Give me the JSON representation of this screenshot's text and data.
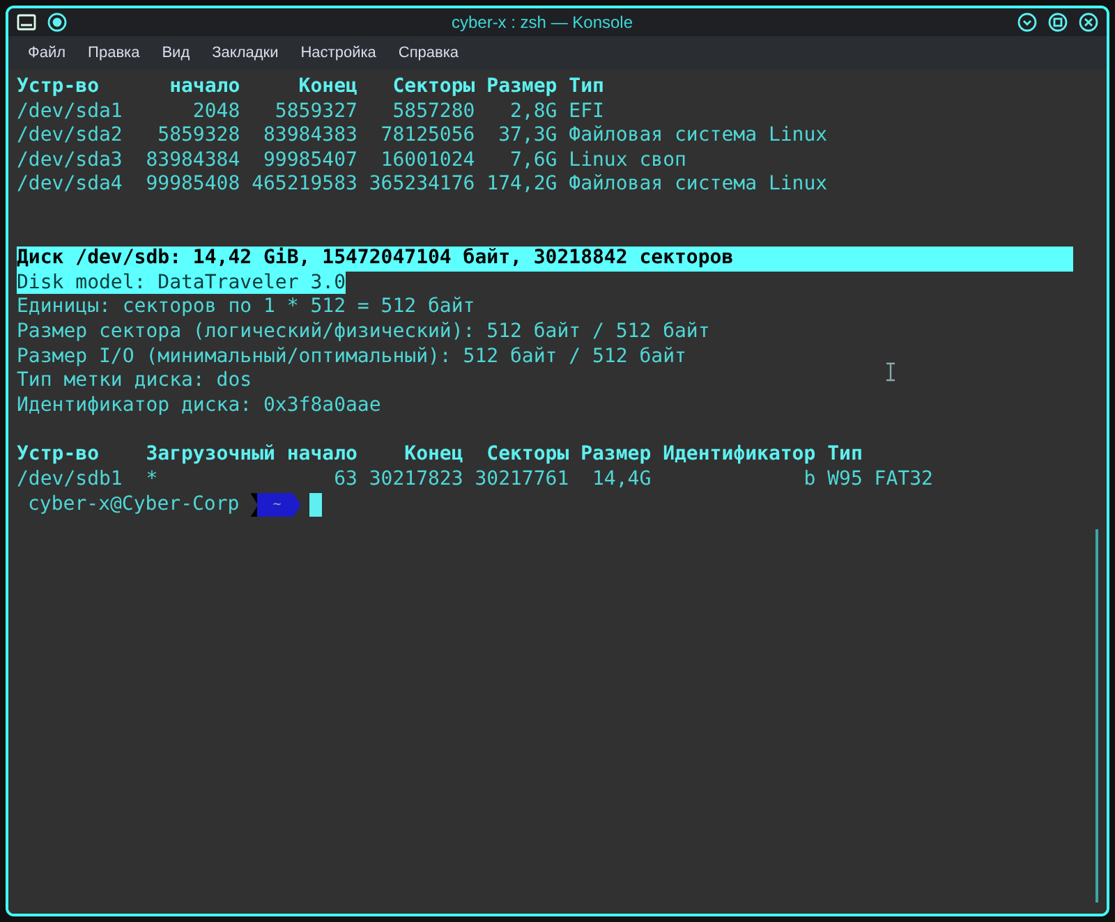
{
  "window": {
    "title": "cyber-x : zsh — Konsole"
  },
  "menu": [
    "Файл",
    "Правка",
    "Вид",
    "Закладки",
    "Настройка",
    "Справка"
  ],
  "terminal": {
    "lines": [
      {
        "kind": "header",
        "text": "Устр-во      начало     Конец   Секторы Размер Тип"
      },
      {
        "kind": "output",
        "text": "/dev/sda1      2048   5859327   5857280   2,8G EFI"
      },
      {
        "kind": "output",
        "text": "/dev/sda2   5859328  83984383  78125056  37,3G Файловая система Linux"
      },
      {
        "kind": "output",
        "text": "/dev/sda3  83984384  99985407  16001024   7,6G Linux своп"
      },
      {
        "kind": "output",
        "text": "/dev/sda4  99985408 465219583 365234176 174,2G Файловая система Linux"
      },
      {
        "kind": "blank"
      },
      {
        "kind": "blank"
      },
      {
        "kind": "selected_header",
        "text": "Диск /dev/sdb: 14,42 GiB, 15472047104 байт, 30218842 секторов"
      },
      {
        "kind": "selected",
        "text": "Disk model: DataTraveler 3.0"
      },
      {
        "kind": "output",
        "text": "Единицы: секторов по 1 * 512 = 512 байт"
      },
      {
        "kind": "output",
        "text": "Размер сектора (логический/физический): 512 байт / 512 байт"
      },
      {
        "kind": "output",
        "text": "Размер I/O (минимальный/оптимальный): 512 байт / 512 байт"
      },
      {
        "kind": "output",
        "text": "Тип метки диска: dos"
      },
      {
        "kind": "output",
        "text": "Идентификатор диска: 0x3f8a0aae"
      },
      {
        "kind": "blank"
      },
      {
        "kind": "header",
        "text": "Устр-во    Загрузочный начало    Конец  Секторы Размер Идентификатор Тип"
      },
      {
        "kind": "output",
        "text": "/dev/sdb1  *               63 30217823 30217761  14,4G             b W95 FAT32"
      }
    ],
    "prompt": {
      "user_host": "cyber-x@Cyber-Corp",
      "path": "~"
    }
  }
}
